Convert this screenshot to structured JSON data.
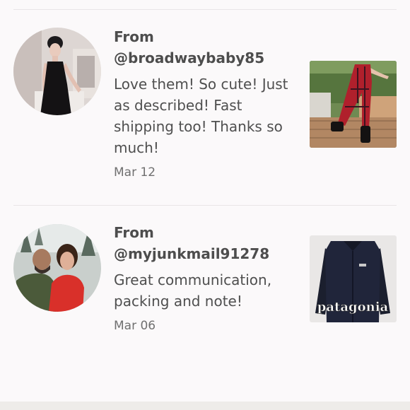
{
  "reviews": [
    {
      "from_label": "From",
      "handle": "@broadwaybaby85",
      "comment": "Love them! So cute! Just as described! Fast shipping too! Thanks so much!",
      "date": "Mar 12"
    },
    {
      "from_label": "From",
      "handle": "@myjunkmail91278",
      "comment": "Great communication, packing and note!",
      "date": "Mar 06",
      "product_brand_text": "patagonia"
    }
  ],
  "colors": {
    "background": "#fbf9fa",
    "divider": "#e9e5e7",
    "text": "#4d4d4d",
    "date_text": "#707070"
  }
}
